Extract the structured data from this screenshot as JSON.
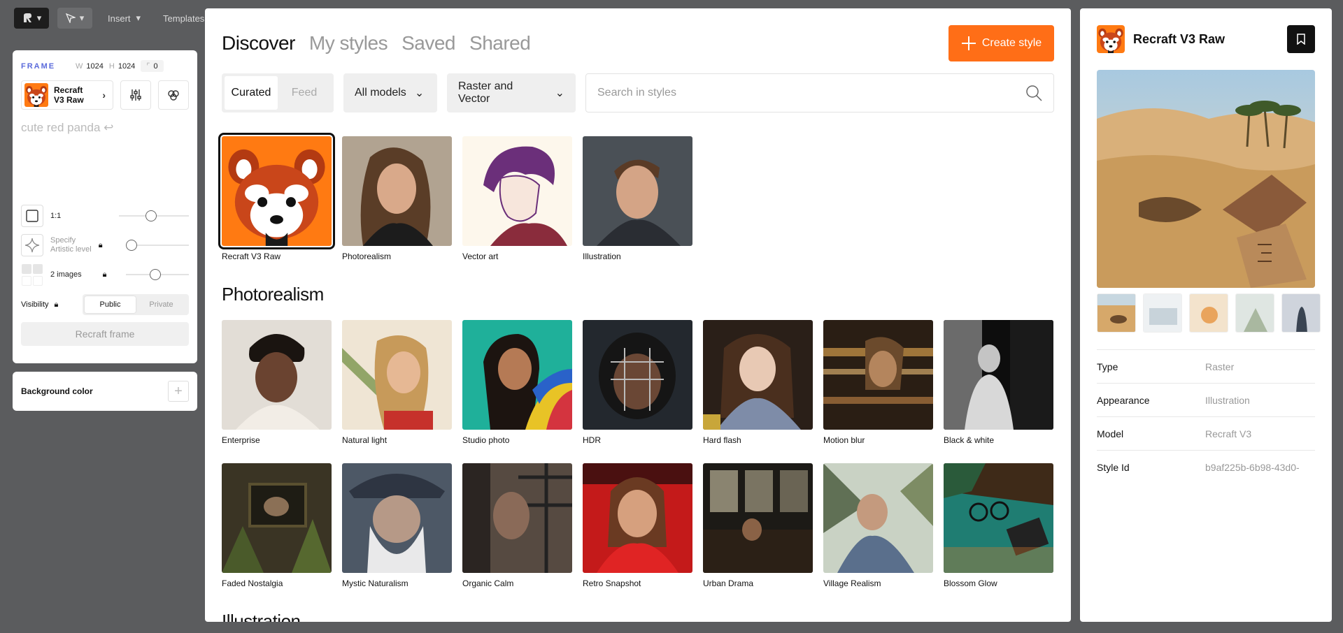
{
  "toolbar": {
    "insert": "Insert",
    "templates": "Templates"
  },
  "left": {
    "frame_label": "FRAME",
    "w_label": "W",
    "w": "1024",
    "h_label": "H",
    "h": "1024",
    "r_label": "⌜",
    "r": "0",
    "style_name_1": "Recraft",
    "style_name_2": "V3 Raw",
    "prompt": "cute red panda ↩",
    "aspect": "1:1",
    "artistic_1": "Specify",
    "artistic_2": "Artistic level",
    "images": "2 images",
    "visibility": "Visibility",
    "public": "Public",
    "private": "Private",
    "frame_button": "Recraft frame",
    "bg_color": "Background color"
  },
  "modal": {
    "tabs": [
      "Discover",
      "My styles",
      "Saved",
      "Shared"
    ],
    "create": "Create style",
    "curated": "Curated",
    "feed": "Feed",
    "models": "All models",
    "kind": "Raster and Vector",
    "search_placeholder": "Search in styles",
    "top_cards": [
      "Recraft V3 Raw",
      "Photorealism",
      "Vector art",
      "Illustration"
    ],
    "section_photo": "Photorealism",
    "row1": [
      "Enterprise",
      "Natural light",
      "Studio photo",
      "HDR",
      "Hard flash",
      "Motion blur",
      "Black & white"
    ],
    "row2": [
      "Faded Nostalgia",
      "Mystic Naturalism",
      "Organic Calm",
      "Retro Snapshot",
      "Urban Drama",
      "Village Realism",
      "Blossom Glow"
    ],
    "section_illus": "Illustration"
  },
  "right": {
    "title": "Recraft V3 Raw",
    "props": [
      {
        "k": "Type",
        "v": "Raster"
      },
      {
        "k": "Appearance",
        "v": "Illustration"
      },
      {
        "k": "Model",
        "v": "Recraft V3"
      },
      {
        "k": "Style Id",
        "v": "b9af225b-6b98-43d0-"
      }
    ]
  }
}
